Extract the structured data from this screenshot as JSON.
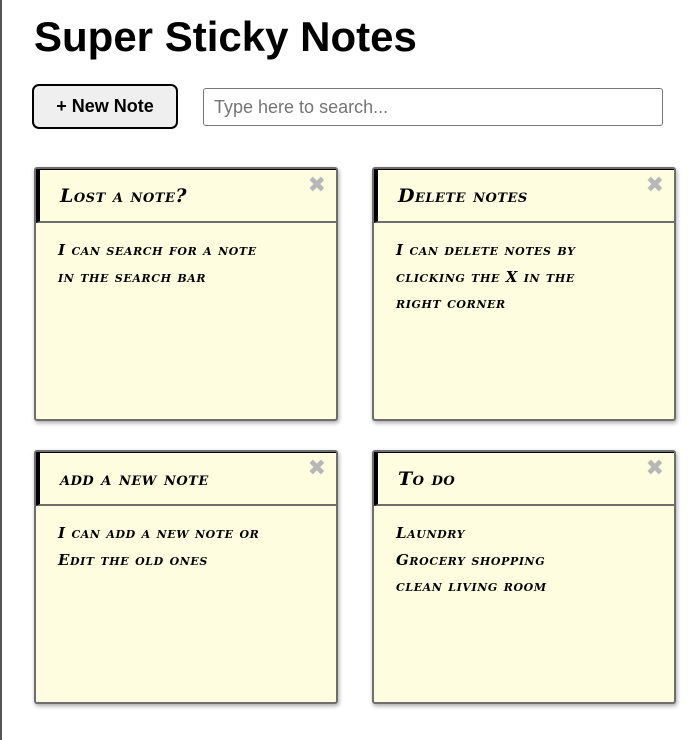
{
  "app": {
    "title": "Super Sticky Notes"
  },
  "toolbar": {
    "new_note_plus": "+",
    "new_note_label": "New Note",
    "search_placeholder": "Type here to search...",
    "search_value": ""
  },
  "notes": [
    {
      "title": "Lost a note?",
      "body": "I can search for a note\nin the search bar",
      "close": "✖"
    },
    {
      "title": "Delete notes",
      "body": "I can delete notes by\nclicking the X in the\nright corner",
      "close": "✖"
    },
    {
      "title": "add a new note",
      "body": "I can add a new note or\nEdit the old ones",
      "close": "✖"
    },
    {
      "title": "To do",
      "body": "Laundry\nGrocery shopping\nclean living room",
      "close": "✖"
    }
  ],
  "colors": {
    "note_background": "#fefde0",
    "note_border": "#6e6e6e",
    "close_icon": "#b7b7b7",
    "button_background": "#efefef"
  },
  "icons": {
    "close": "close-icon",
    "plus": "plus-icon"
  }
}
